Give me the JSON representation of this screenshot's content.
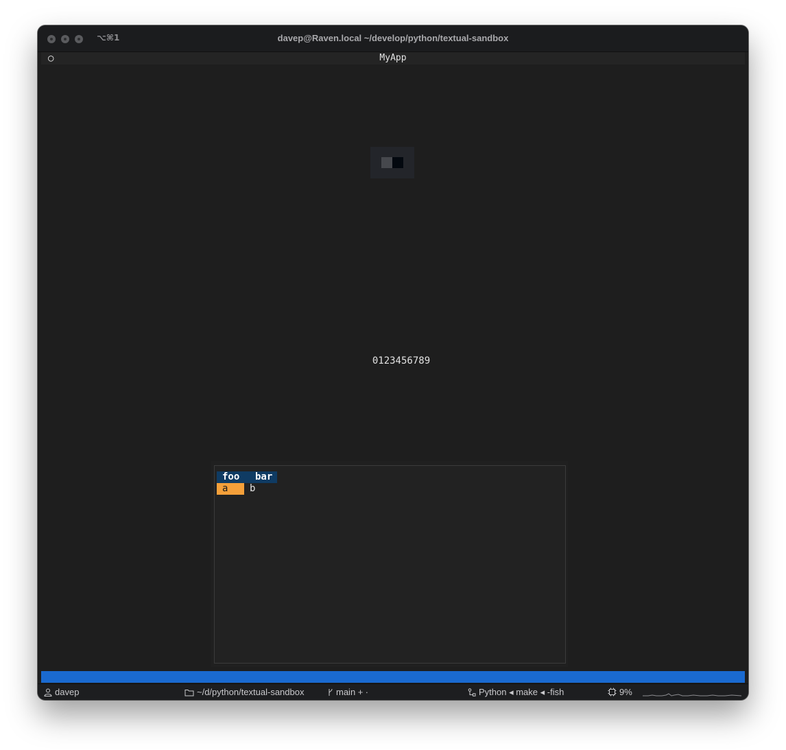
{
  "window": {
    "title": "davep@Raven.local ~/develop/python/textual-sandbox",
    "shortcut": "⌥⌘1"
  },
  "app": {
    "header_icon": "○",
    "title": "MyApp",
    "digits": "0123456789"
  },
  "table": {
    "columns": [
      "foo",
      "bar"
    ],
    "rows": [
      [
        "a",
        "b"
      ]
    ]
  },
  "statusbar": {
    "user": "davep",
    "directory": "~/d/python/textual-sandbox",
    "git": "main + ∙",
    "process": "Python ◂ make ◂ -fish",
    "cpu": "9%"
  },
  "colors": {
    "footer_bar": "#1a6ad0",
    "table_header": "#0f3b63",
    "cursor_cell": "#f4a03a"
  }
}
